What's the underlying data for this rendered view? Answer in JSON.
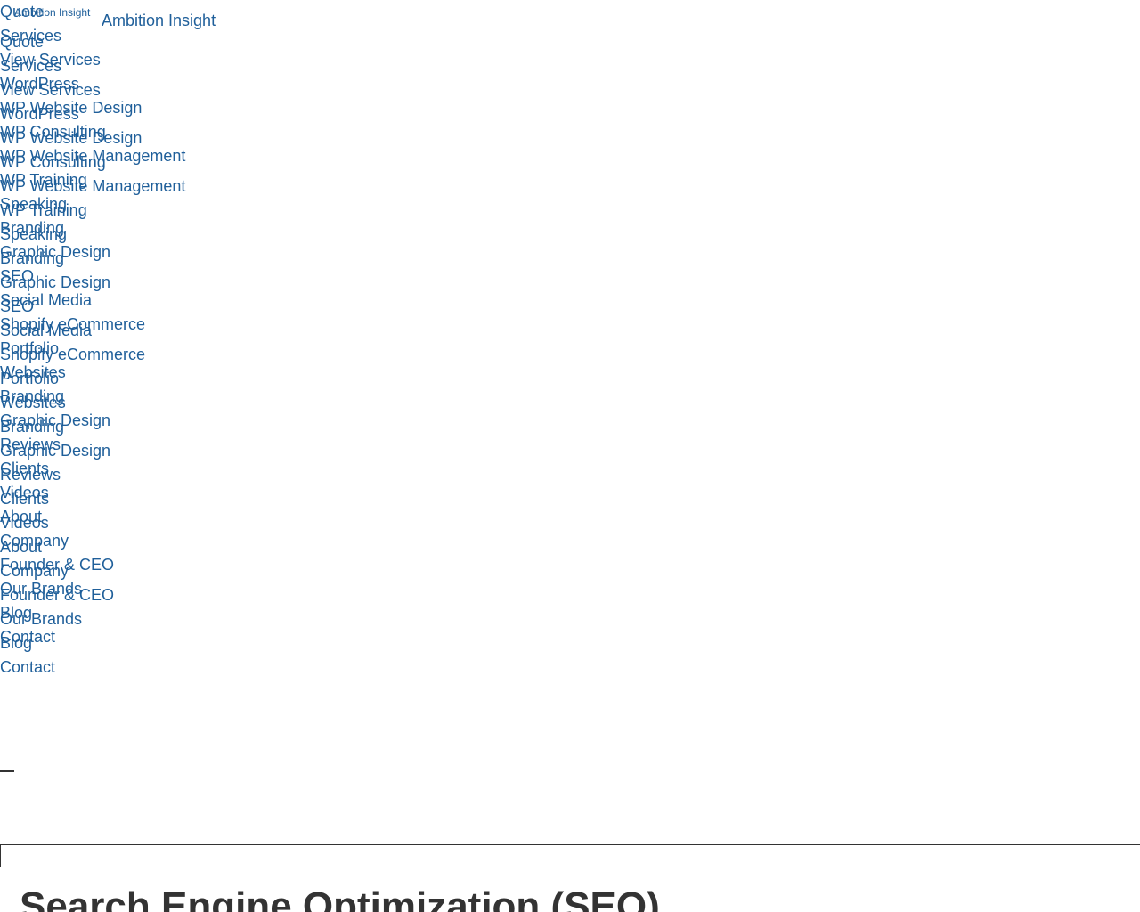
{
  "brand": {
    "logo_alt": "Ambition Insight",
    "name": "Ambition Insight"
  },
  "nav": {
    "items": [
      "Quote",
      "Services",
      "View Services",
      "WordPress",
      "WP Website Design",
      "WP Consulting",
      "WP Website Management",
      "WP Training",
      "Speaking",
      "Branding",
      "Graphic Design",
      "SEO",
      "Social Media",
      "Shopify eCommerce",
      "Portfolio",
      "Websites",
      "Branding",
      "Graphic Design",
      "Reviews",
      "Clients",
      "Videos",
      "About",
      "Company",
      "Founder & CEO",
      "Our Brands",
      "Blog",
      "Contact"
    ]
  },
  "search": {
    "value": "",
    "placeholder": ""
  },
  "main": {
    "heading": "Search Engine Optimization (SEO)"
  },
  "colors": {
    "link": "#1f5f9a",
    "text": "#333333",
    "background": "#ffffff"
  }
}
